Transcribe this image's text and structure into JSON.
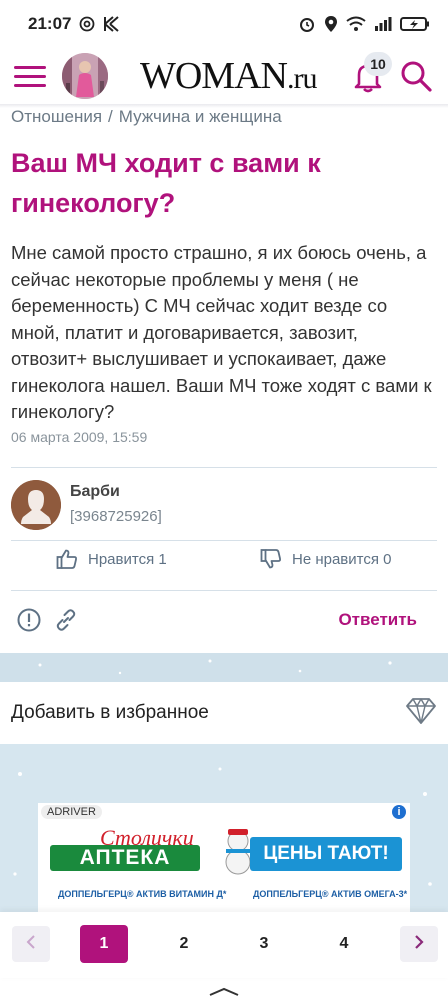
{
  "status": {
    "time": "21:07",
    "battery_label": "battery charging"
  },
  "header": {
    "logo_main": "WOMAN",
    "logo_suffix": ".ru",
    "notifications_count": "10"
  },
  "breadcrumb": {
    "items": [
      "Отношения",
      "/",
      "Мужчина и женщина"
    ]
  },
  "article": {
    "title": "Ваш МЧ ходит с вами к гинекологу?",
    "text": "Мне самой просто страшно, я их боюсь очень, а сейчас некоторые проблемы у меня ( не беременность) С МЧ сейчас ходит везде со мной, платит и договаривается, завозит, отвозит+ выслушивает и успокаивает, даже гинеколога нашел. Ваши МЧ тоже ходят с вами к гинекологу?",
    "date": "06 марта 2009, 15:59"
  },
  "author": {
    "name": "Барби",
    "id": "[3968725926]"
  },
  "votes": {
    "like_label": "Нравится 1",
    "dislike_label": "Не нравится 0"
  },
  "actions": {
    "reply_label": "Ответить"
  },
  "favorites": {
    "label": "Добавить в избранное"
  },
  "ad": {
    "tag": "ADRIVER",
    "brand_small": "Столички",
    "brand": "АПТЕКА",
    "banner": "ЦЕНЫ ТАЮТ!",
    "product1": "ДОППЕЛЬГЕРЦ® АКТИВ ВИТАМИН Д*",
    "product2": "ДОППЕЛЬГЕРЦ® АКТИВ ОМЕГА-3*"
  },
  "pagination": {
    "pages": [
      "1",
      "2",
      "3",
      "4"
    ],
    "current": "1"
  },
  "colors": {
    "accent": "#b0127c",
    "muted": "#6c7a86",
    "band": "#cfe0ea"
  }
}
